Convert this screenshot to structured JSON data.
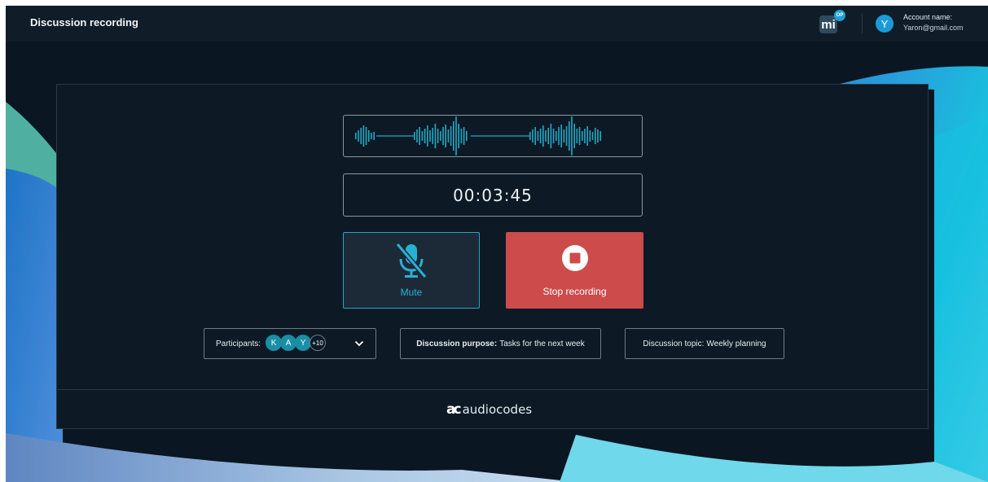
{
  "header": {
    "title": "Discussion recording",
    "app_logo_text": "mi",
    "app_logo_badge": "OP",
    "avatar_initial": "Y",
    "account_label": "Account name:",
    "account_email": "Yaron@gmail.com"
  },
  "recorder": {
    "timer": "00:03:45",
    "mute_label": "Mute",
    "stop_label": "Stop recording"
  },
  "info": {
    "participants_label": "Participants:",
    "participants": [
      "K",
      "A",
      "Y"
    ],
    "participants_more": "+10",
    "purpose_label": "Discussion purpose:",
    "purpose_value": "Tasks for the next week",
    "topic_label": "Discussion topic:",
    "topic_value": "Weekly planning"
  },
  "footer": {
    "brand_mark": "ac",
    "brand_name": "audiocodes"
  },
  "icons": {
    "mic_off": "mic-off-icon",
    "stop": "stop-icon",
    "chevron": "chevron-down-icon"
  },
  "colors": {
    "accent": "#26a6c2",
    "stop": "#cd4b4b",
    "background": "#0a1621"
  }
}
